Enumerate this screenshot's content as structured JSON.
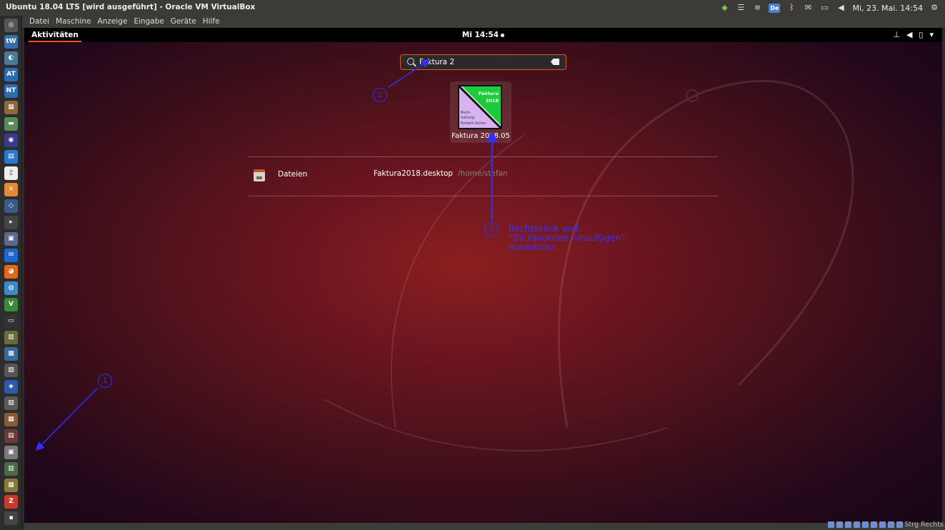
{
  "host": {
    "window_title": "Ubuntu 18.04 LTS [wird ausgeführt] - Oracle VM VirtualBox",
    "tray": {
      "de_badge": "De",
      "datetime": "Mi, 23. Mai. 14:54"
    },
    "launcher_labels": [
      "tW",
      "AT",
      "NT"
    ],
    "status_text": "Strg Rechts"
  },
  "vbox": {
    "menu": [
      "Datei",
      "Maschine",
      "Anzeige",
      "Eingabe",
      "Geräte",
      "Hilfe"
    ]
  },
  "gnome": {
    "activities_label": "Aktivitäten",
    "clock": "Mi 14:54"
  },
  "search": {
    "value": "Faktura 2"
  },
  "app_result": {
    "label": "Faktura 2018.05",
    "icon_text": {
      "top": "Faktura",
      "year": "2018",
      "lines": [
        "Buch-",
        "haltung",
        "Einfach.Sicher."
      ]
    }
  },
  "file_results": {
    "provider": "Dateien",
    "file_name": "Faktura2018.desktop",
    "file_path": "/home/stefan"
  },
  "annotations": {
    "num1": "1",
    "num2": "2",
    "num3": "3",
    "note3": [
      "Rechtsklick und",
      "\"Zu Favoriten hinzufügen\"",
      "auswählen"
    ]
  },
  "colors": {
    "accent": "#e95420",
    "annotation": "#2f2fff"
  }
}
